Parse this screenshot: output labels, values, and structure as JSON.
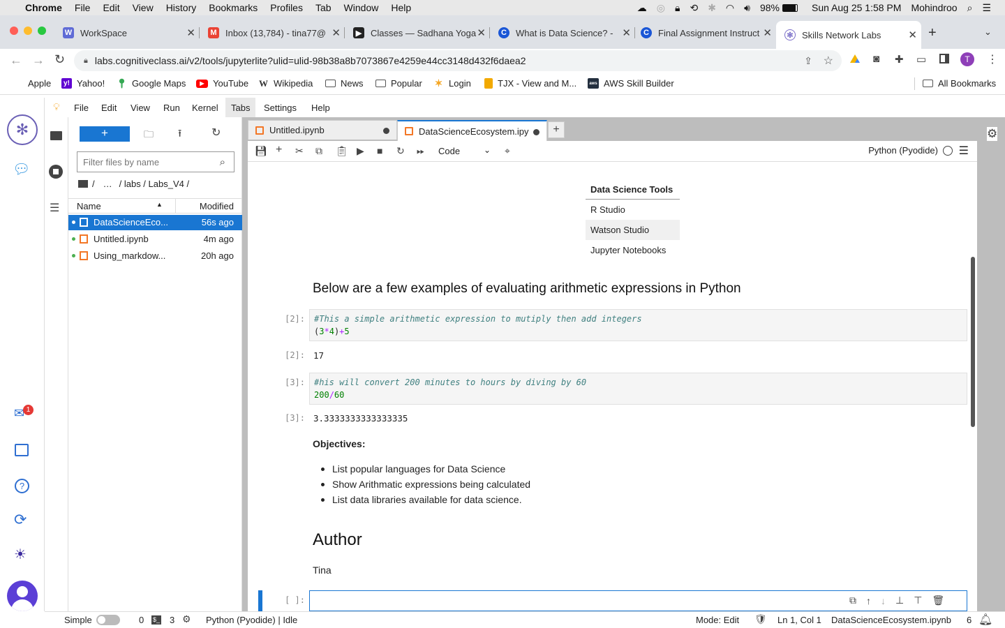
{
  "mac": {
    "app": "Chrome",
    "menus": [
      "File",
      "Edit",
      "View",
      "History",
      "Bookmarks",
      "Profiles",
      "Tab",
      "Window",
      "Help"
    ],
    "battery": "98%",
    "datetime": "Sun Aug 25  1:58 PM",
    "user": "Mohindroo"
  },
  "tabs": [
    {
      "title": "WorkSpace",
      "color": "#5f6bd6",
      "glyph": "W"
    },
    {
      "title": "Inbox (13,784) - tina77@",
      "color": "#ea4335",
      "glyph": "M"
    },
    {
      "title": "Classes — Sadhana Yoga",
      "color": "#222222",
      "glyph": "▶"
    },
    {
      "title": "What is Data Science? -",
      "color": "#1a56d6",
      "glyph": "C"
    },
    {
      "title": "Final Assignment Instruct",
      "color": "#1a56d6",
      "glyph": "C"
    },
    {
      "title": "Skills Network Labs",
      "color": "#7b6fc9",
      "glyph": "✻"
    }
  ],
  "url": "labs.cognitiveclass.ai/v2/tools/jupyterlite?ulid=ulid-98b38a8b7073867e4259e44cc3148d432f6daea2",
  "profile_initial": "T",
  "bookmarks": [
    {
      "label": "Apple",
      "glyph": "",
      "color": "#222222"
    },
    {
      "label": "Yahoo!",
      "glyph": "y!",
      "color": "#6001d2"
    },
    {
      "label": "Google Maps",
      "glyph": "◉",
      "color": "#34a853"
    },
    {
      "label": "YouTube",
      "glyph": "▶",
      "color": "#ff0000"
    },
    {
      "label": "Wikipedia",
      "glyph": "W",
      "color": "#444444"
    },
    {
      "label": "News",
      "glyph": "▭",
      "color": "#555555"
    },
    {
      "label": "Popular",
      "glyph": "▭",
      "color": "#555555"
    },
    {
      "label": "Login",
      "glyph": "✶",
      "color": "#f5a623"
    },
    {
      "label": "TJX - View and M...",
      "glyph": "▮",
      "color": "#f2a900"
    },
    {
      "label": "AWS Skill Builder",
      "glyph": "aws",
      "color": "#232f3e"
    }
  ],
  "all_bookmarks": "All Bookmarks",
  "jmenu": [
    "File",
    "Edit",
    "View",
    "Run",
    "Kernel",
    "Tabs",
    "Settings",
    "Help"
  ],
  "filebrowser": {
    "filter_placeholder": "Filter files by name",
    "path": [
      "/",
      "…",
      "/ labs / Labs_V4 /"
    ],
    "col_name": "Name",
    "col_modified": "Modified",
    "files": [
      {
        "name": "DataScienceEco...",
        "modified": "56s ago"
      },
      {
        "name": "Untitled.ipynb",
        "modified": "4m ago"
      },
      {
        "name": "Using_markdow...",
        "modified": "20h ago"
      }
    ]
  },
  "doctabs": [
    {
      "title": "Untitled.ipynb"
    },
    {
      "title": "DataScienceEcosystem.ipy"
    }
  ],
  "toolbar": {
    "celltype": "Code",
    "kernel": "Python (Pyodide)"
  },
  "notebook": {
    "table": {
      "header": "Data Science Tools",
      "rows": [
        "R Studio",
        "Watson Studio",
        "Jupyter Notebooks"
      ]
    },
    "heading": "Below are a few examples of evaluating arithmetic expressions in Python",
    "cell2": {
      "prompt": "[2]:",
      "comment": "#This a simple arithmetic expression to mutiply then add integers",
      "out_prompt": "[2]:",
      "output": "17"
    },
    "cell3": {
      "prompt": "[3]:",
      "comment": "#his will convert 200 minutes to hours by diving by 60",
      "out_prompt": "[3]:",
      "output": "3.3333333333333335"
    },
    "objectives_title": "Objectives:",
    "objectives": [
      "List popular languages for Data Science",
      "Show Arithmatic expressions being calculated",
      "List data libraries available for data science."
    ],
    "author_heading": "Author",
    "author": "Tina",
    "empty_prompt": "[ ]:"
  },
  "status": {
    "mode_label": "Simple",
    "zero": "0",
    "three": "3",
    "kernel": "Python (Pyodide) | Idle",
    "mode": "Mode: Edit",
    "cursor": "Ln 1, Col 1",
    "file": "DataScienceEcosystem.ipynb",
    "count": "6"
  },
  "badge": "1"
}
